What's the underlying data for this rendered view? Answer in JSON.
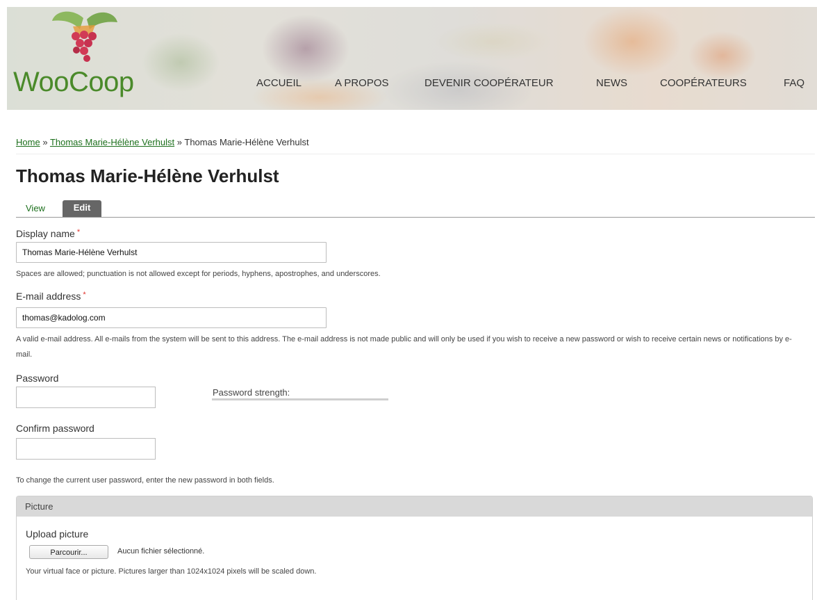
{
  "header": {
    "site_name": "WooCoop",
    "nav": [
      "ACCUEIL",
      "A PROPOS",
      "DEVENIR COOPÉRATEUR",
      "NEWS",
      "COOPÉRATEURS",
      "FAQ"
    ]
  },
  "breadcrumb": {
    "home": "Home",
    "separator": "»",
    "parent": "Thomas Marie-Hélène Verhulst",
    "current": "Thomas Marie-Hélène Verhulst"
  },
  "page_title": "Thomas Marie-Hélène Verhulst",
  "tabs": {
    "view": "View",
    "edit": "Edit"
  },
  "form": {
    "display_name": {
      "label": "Display name",
      "required_marker": "*",
      "value": "Thomas Marie-Hélène Verhulst",
      "description": "Spaces are allowed; punctuation is not allowed except for periods, hyphens, apostrophes, and underscores."
    },
    "email": {
      "label": "E-mail address",
      "required_marker": "*",
      "value": "thomas@kadolog.com",
      "description": "A valid e-mail address. All e-mails from the system will be sent to this address. The e-mail address is not made public and will only be used if you wish to receive a new password or wish to receive certain news or notifications by e-mail."
    },
    "password": {
      "label": "Password",
      "strength_label": "Password strength:",
      "strength_fraction": 0
    },
    "confirm_password": {
      "label": "Confirm password"
    },
    "password_description": "To change the current user password, enter the new password in both fields.",
    "picture": {
      "legend": "Picture",
      "upload_label": "Upload picture",
      "browse_button": "Parcourir...",
      "file_status": "Aucun fichier sélectionné.",
      "description": "Your virtual face or picture. Pictures larger than 1024x1024 pixels will be scaled down."
    }
  },
  "colors": {
    "brand_green": "#4a8a2a",
    "link_green": "#1c6f1c",
    "required_red": "#e0302a",
    "active_tab": "#666666"
  }
}
